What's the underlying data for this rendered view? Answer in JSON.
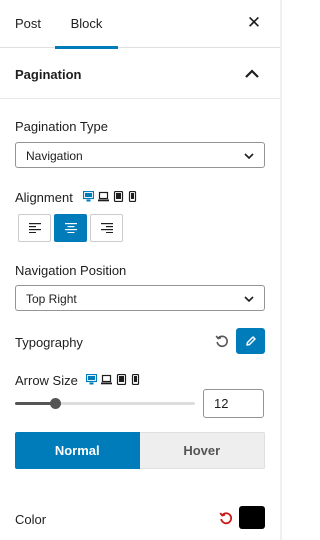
{
  "tabs": {
    "post": "Post",
    "block": "Block",
    "close": "✕"
  },
  "panel": {
    "title": "Pagination"
  },
  "pagination_type": {
    "label": "Pagination Type",
    "value": "Navigation"
  },
  "alignment": {
    "label": "Alignment",
    "options": [
      "align-left",
      "align-center",
      "align-right"
    ],
    "selected": "align-center"
  },
  "navigation_position": {
    "label": "Navigation Position",
    "value": "Top Right"
  },
  "typography": {
    "label": "Typography"
  },
  "arrow_size": {
    "label": "Arrow Size",
    "value": "12",
    "slider_fraction": 0.15
  },
  "state_tabs": {
    "normal": "Normal",
    "hover": "Hover",
    "active": "Normal"
  },
  "color": {
    "label": "Color",
    "value": "#000000",
    "reset_color": "#cc1818"
  },
  "colors": {
    "accent": "#007cba",
    "device_active": "#007cba",
    "device_inactive": "#1e1e1e"
  }
}
